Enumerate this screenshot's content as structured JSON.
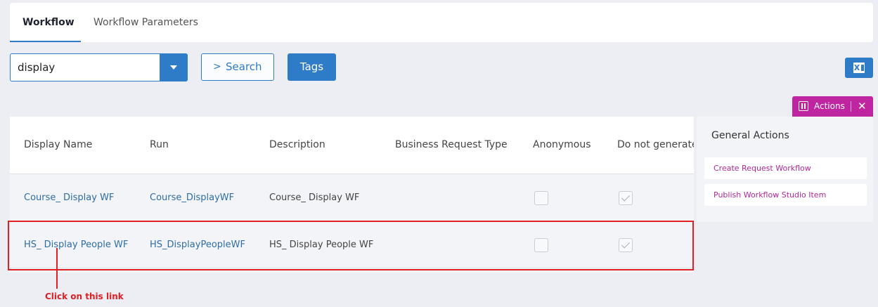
{
  "tabs": [
    {
      "label": "Workflow",
      "active": true
    },
    {
      "label": "Workflow Parameters",
      "active": false
    }
  ],
  "filter": {
    "select_value": "display",
    "search_label": "Search",
    "tags_label": "Tags"
  },
  "export": {
    "icon": "excel-icon",
    "glyph": "X"
  },
  "actions": {
    "label": "Actions",
    "close_glyph": "✕"
  },
  "table": {
    "headers": [
      "Display Name",
      "Run",
      "Description",
      "Business Request Type",
      "Anonymous",
      "Do not generate"
    ],
    "rows": [
      {
        "display_name": "Course_ Display WF",
        "run": "Course_DisplayWF",
        "description": "Course_ Display WF",
        "business_request_type": "",
        "anonymous": false,
        "do_not_generate": true
      },
      {
        "display_name": "HS_ Display People WF",
        "run": "HS_DisplayPeopleWF",
        "description": "HS_ Display People WF",
        "business_request_type": "",
        "anonymous": false,
        "do_not_generate": true
      }
    ]
  },
  "general_actions": {
    "title": "General Actions",
    "items": [
      "Create Request Workflow",
      "Publish Workflow Studio Item"
    ]
  },
  "annotation": {
    "callout": "Click on this link",
    "color": "#e02025"
  },
  "colors": {
    "primary": "#2e7bc7",
    "actions_magenta": "#c025a1",
    "link": "#2e6da4"
  }
}
